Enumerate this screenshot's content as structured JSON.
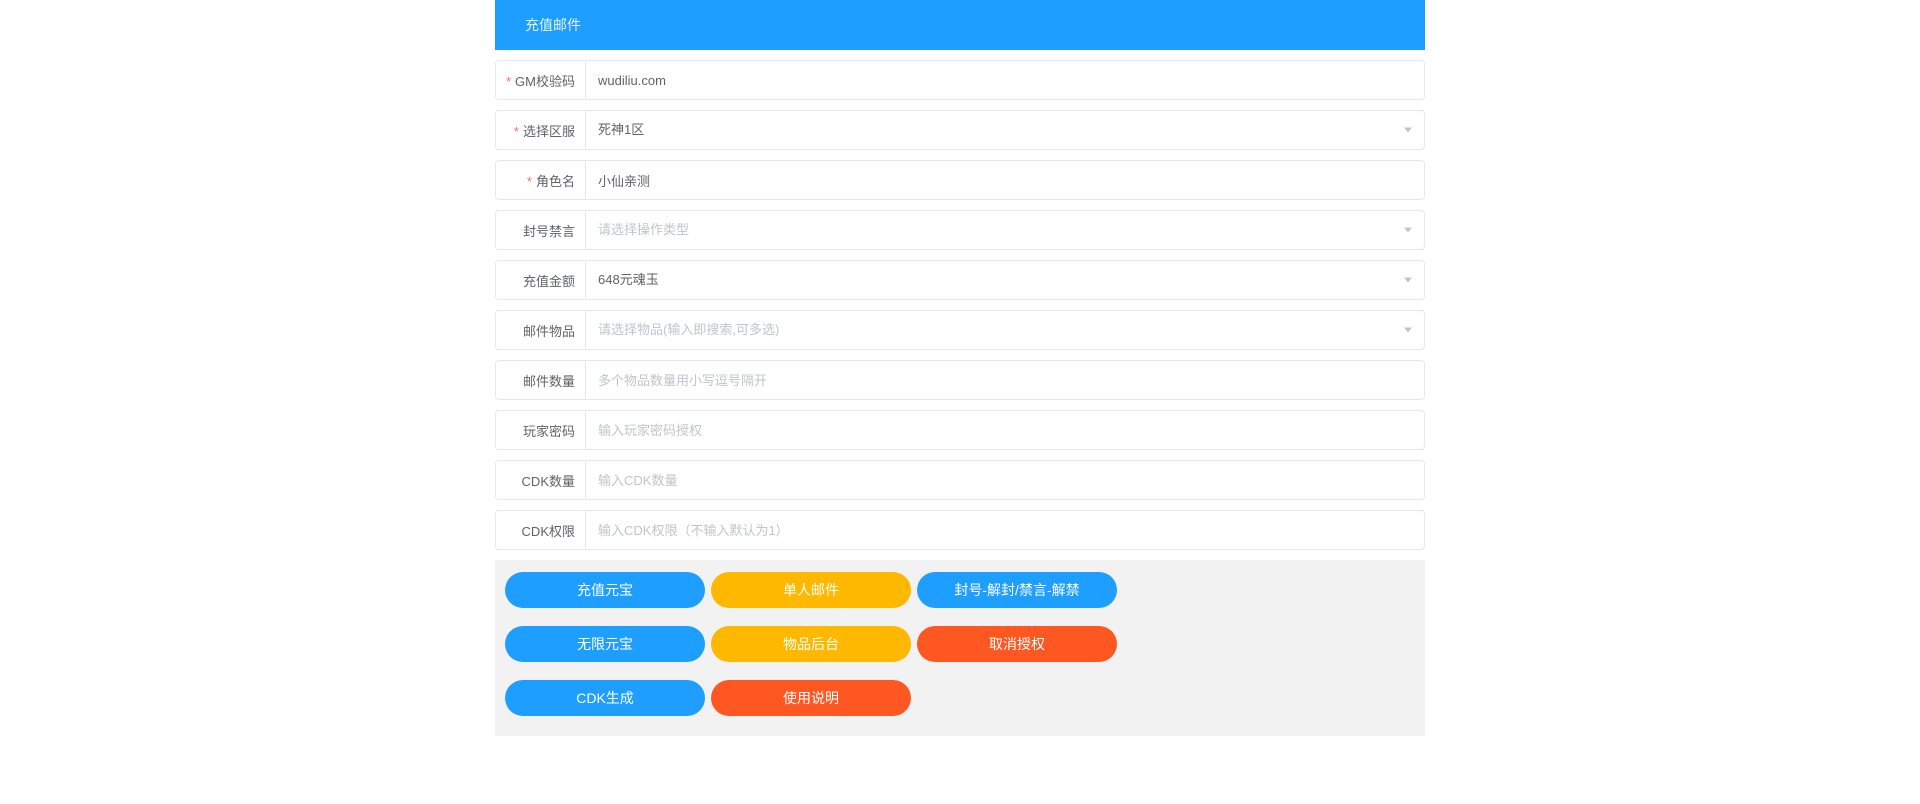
{
  "header": {
    "title": "充值邮件"
  },
  "fields": {
    "gmCode": {
      "label": "GM校验码",
      "value": "wudiliu.com",
      "required": true
    },
    "server": {
      "label": "选择区服",
      "value": "死神1区",
      "required": true
    },
    "roleName": {
      "label": "角色名",
      "value": "小仙亲测",
      "required": true
    },
    "ban": {
      "label": "封号禁言",
      "placeholder": "请选择操作类型"
    },
    "amount": {
      "label": "充值金额",
      "value": "648元魂玉"
    },
    "items": {
      "label": "邮件物品",
      "placeholder": "请选择物品(输入即搜索,可多选)"
    },
    "itemQty": {
      "label": "邮件数量",
      "placeholder": "多个物品数量用小写逗号隔开"
    },
    "playerPw": {
      "label": "玩家密码",
      "placeholder": "输入玩家密码授权"
    },
    "cdkQty": {
      "label": "CDK数量",
      "placeholder": "输入CDK数量"
    },
    "cdkPerm": {
      "label": "CDK权限",
      "placeholder": "输入CDK权限（不输入默认为1）"
    }
  },
  "buttons": {
    "recharge": "充值元宝",
    "singleMail": "单人邮件",
    "banUnban": "封号-解封/禁言-解禁",
    "unlimited": "无限元宝",
    "itemAdmin": "物品后台",
    "revokeAuth": "取消授权",
    "cdkGen": "CDK生成",
    "manual": "使用说明"
  }
}
